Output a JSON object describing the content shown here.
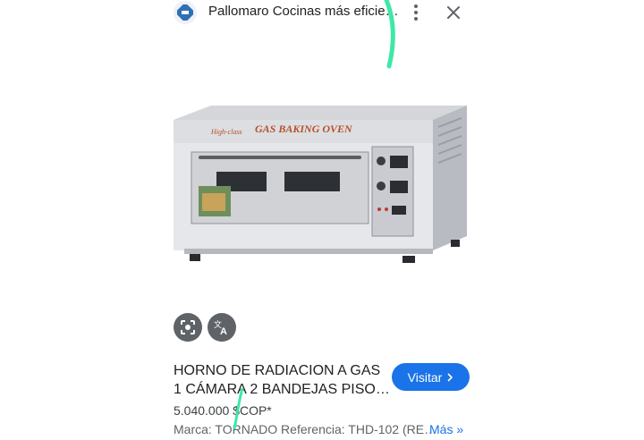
{
  "header": {
    "site_name": "Pallomaro Cocinas más eficie…",
    "logo_icon": "pallomaro-logo-icon",
    "more_icon": "more-vert-icon",
    "close_icon": "close-icon"
  },
  "image": {
    "oven_brand_text": "High-class",
    "oven_title_text": "GAS BAKING OVEN"
  },
  "actions": {
    "lens_icon": "lens-search-icon",
    "translate_icon": "translate-icon"
  },
  "result": {
    "title_line1": "HORNO DE RADIACION A GAS",
    "title_line2": "1 CÁMARA 2 BANDEJAS PISO…",
    "price": "5.040.000 $COP*",
    "description": "Marca: TORNADO Referencia: THD-102 (RE…",
    "more_label": "Más »",
    "visit_label": "Visitar",
    "visit_icon": "chevron-right-icon"
  },
  "colors": {
    "accent_blue": "#1a73e8",
    "icon_button_bg": "#5f6368",
    "annotation_stroke": "#3ee8a6"
  }
}
